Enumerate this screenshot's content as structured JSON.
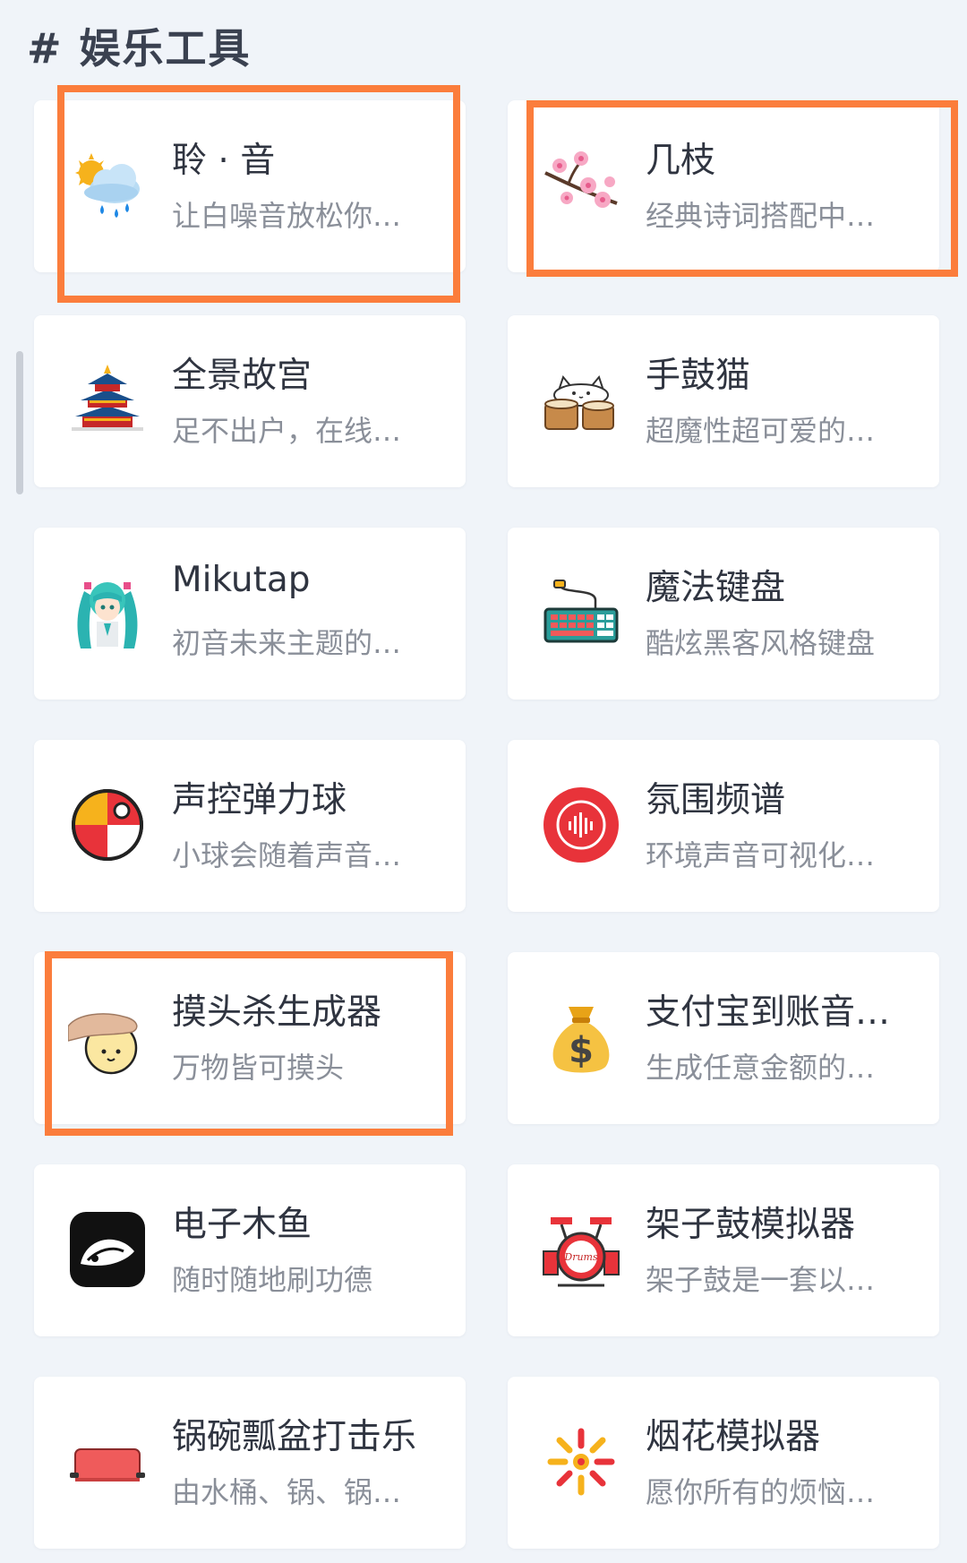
{
  "section": {
    "title": "# 娱乐工具"
  },
  "cards": [
    {
      "title": "聆 · 音",
      "desc": "让白噪音放松你…",
      "icon": "weather-rain-icon"
    },
    {
      "title": "几枝",
      "desc": "经典诗词搭配中…",
      "icon": "cherry-blossom-icon"
    },
    {
      "title": "全景故宫",
      "desc": "足不出户，在线…",
      "icon": "temple-icon"
    },
    {
      "title": "手鼓猫",
      "desc": "超魔性超可爱的…",
      "icon": "bongo-cat-icon"
    },
    {
      "title": "Mikutap",
      "desc": "初音未来主题的…",
      "icon": "miku-icon"
    },
    {
      "title": "魔法键盘",
      "desc": "酷炫黑客风格键盘",
      "icon": "keyboard-icon"
    },
    {
      "title": "声控弹力球",
      "desc": "小球会随着声音…",
      "icon": "beach-ball-icon"
    },
    {
      "title": "氛围频谱",
      "desc": "环境声音可视化…",
      "icon": "spectrum-icon"
    },
    {
      "title": "摸头杀生成器",
      "desc": "万物皆可摸头",
      "icon": "head-pat-icon"
    },
    {
      "title": "支付宝到账音…",
      "desc": "生成任意金额的…",
      "icon": "money-bag-icon"
    },
    {
      "title": "电子木鱼",
      "desc": "随时随地刷功德",
      "icon": "wooden-fish-icon"
    },
    {
      "title": "架子鼓模拟器",
      "desc": "架子鼓是一套以…",
      "icon": "drum-kit-icon",
      "icon_text": "Drums"
    },
    {
      "title": "锅碗瓢盆打击乐",
      "desc": "由水桶、锅、锅…",
      "icon": "pot-icon"
    },
    {
      "title": "烟花模拟器",
      "desc": "愿你所有的烦恼…",
      "icon": "firework-icon"
    }
  ],
  "highlight_color": "#fb7d3c"
}
